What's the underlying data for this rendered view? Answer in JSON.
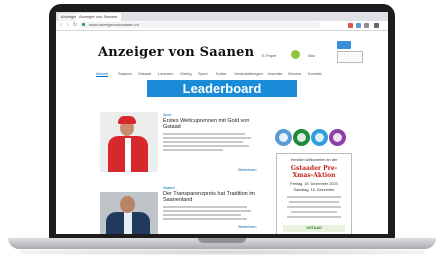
{
  "browser": {
    "tabs": [
      {
        "label": "Anzeiger"
      },
      {
        "label": "Anzeiger von Saanen"
      }
    ],
    "url": "www.anzeigervonsaanen.ch"
  },
  "site": {
    "logo": "Anzeiger von Saanen",
    "header_links": [
      "E-Paper",
      "Abo"
    ],
    "nav": [
      "Aktuell",
      "Saanen",
      "Gstaad",
      "Lauenen",
      "Gsteig",
      "Sport",
      "Kultur",
      "Veranstaltungen",
      "Inserate",
      "Service",
      "Kontakt"
    ]
  },
  "leaderboard": {
    "label": "Leaderboard"
  },
  "articles": [
    {
      "kicker": "Sport",
      "headline": "Erstes Weltcuprennen mit Gold von Gstaad",
      "more": "Weiterlesen"
    },
    {
      "kicker": "Saanen",
      "headline": "Der Transparenzpreis hat Tradition im Saanenland",
      "more": "Weiterlesen"
    }
  ],
  "ad": {
    "intro": "Herzlich willkommen an der",
    "title": "Gstaader Pre-Xmas-Aktion",
    "date": "Freitag, 15. Dezember 2023",
    "time": "Samstag, 16. Dezember",
    "footer": "GSTAAD"
  },
  "social_colors": [
    "#5b9bd5",
    "#1f8a3a",
    "#2e9fdf",
    "#8e3ea8"
  ]
}
